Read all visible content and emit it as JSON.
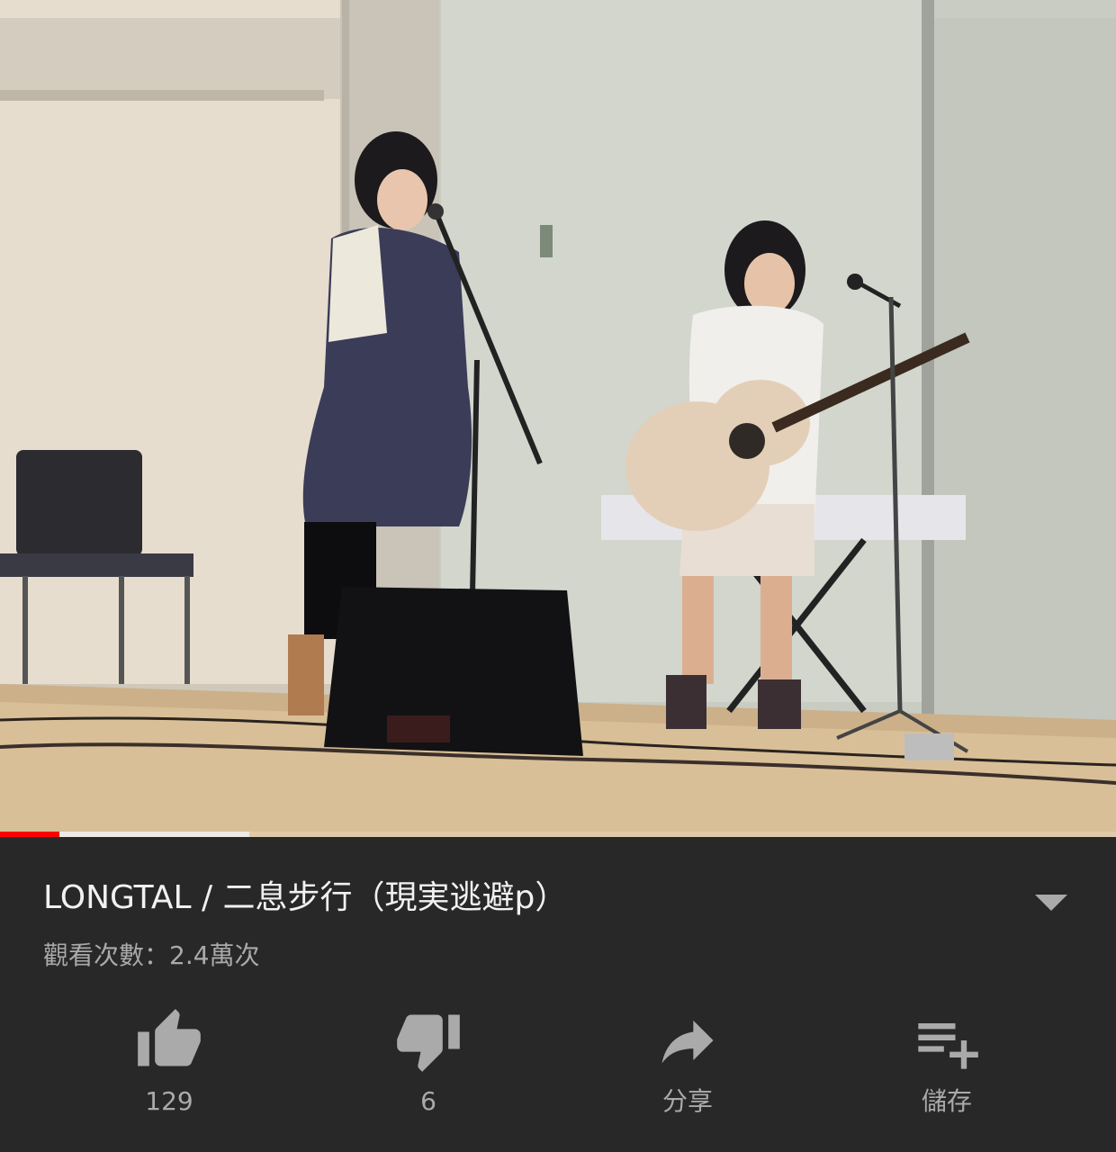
{
  "video": {
    "progress_played_fraction": 0.053,
    "progress_buffered_fraction": 0.223,
    "colors": {
      "played": "#ff0000",
      "buffered": "#f0f0f0"
    }
  },
  "info": {
    "title": "LONGTAL / 二息步行（現実逃避p）",
    "views": "觀看次數：2.4萬次",
    "expand_icon": "chevron-down-icon"
  },
  "actions": {
    "like": {
      "icon": "thumbs-up-icon",
      "label": "129"
    },
    "dislike": {
      "icon": "thumbs-down-icon",
      "label": "6"
    },
    "share": {
      "icon": "share-icon",
      "label": "分享"
    },
    "save": {
      "icon": "playlist-add-icon",
      "label": "儲存"
    }
  },
  "colors": {
    "background": "#282828",
    "title_text": "#f1f1f1",
    "secondary_text": "#aaaaaa",
    "icon": "#aaaaaa"
  }
}
